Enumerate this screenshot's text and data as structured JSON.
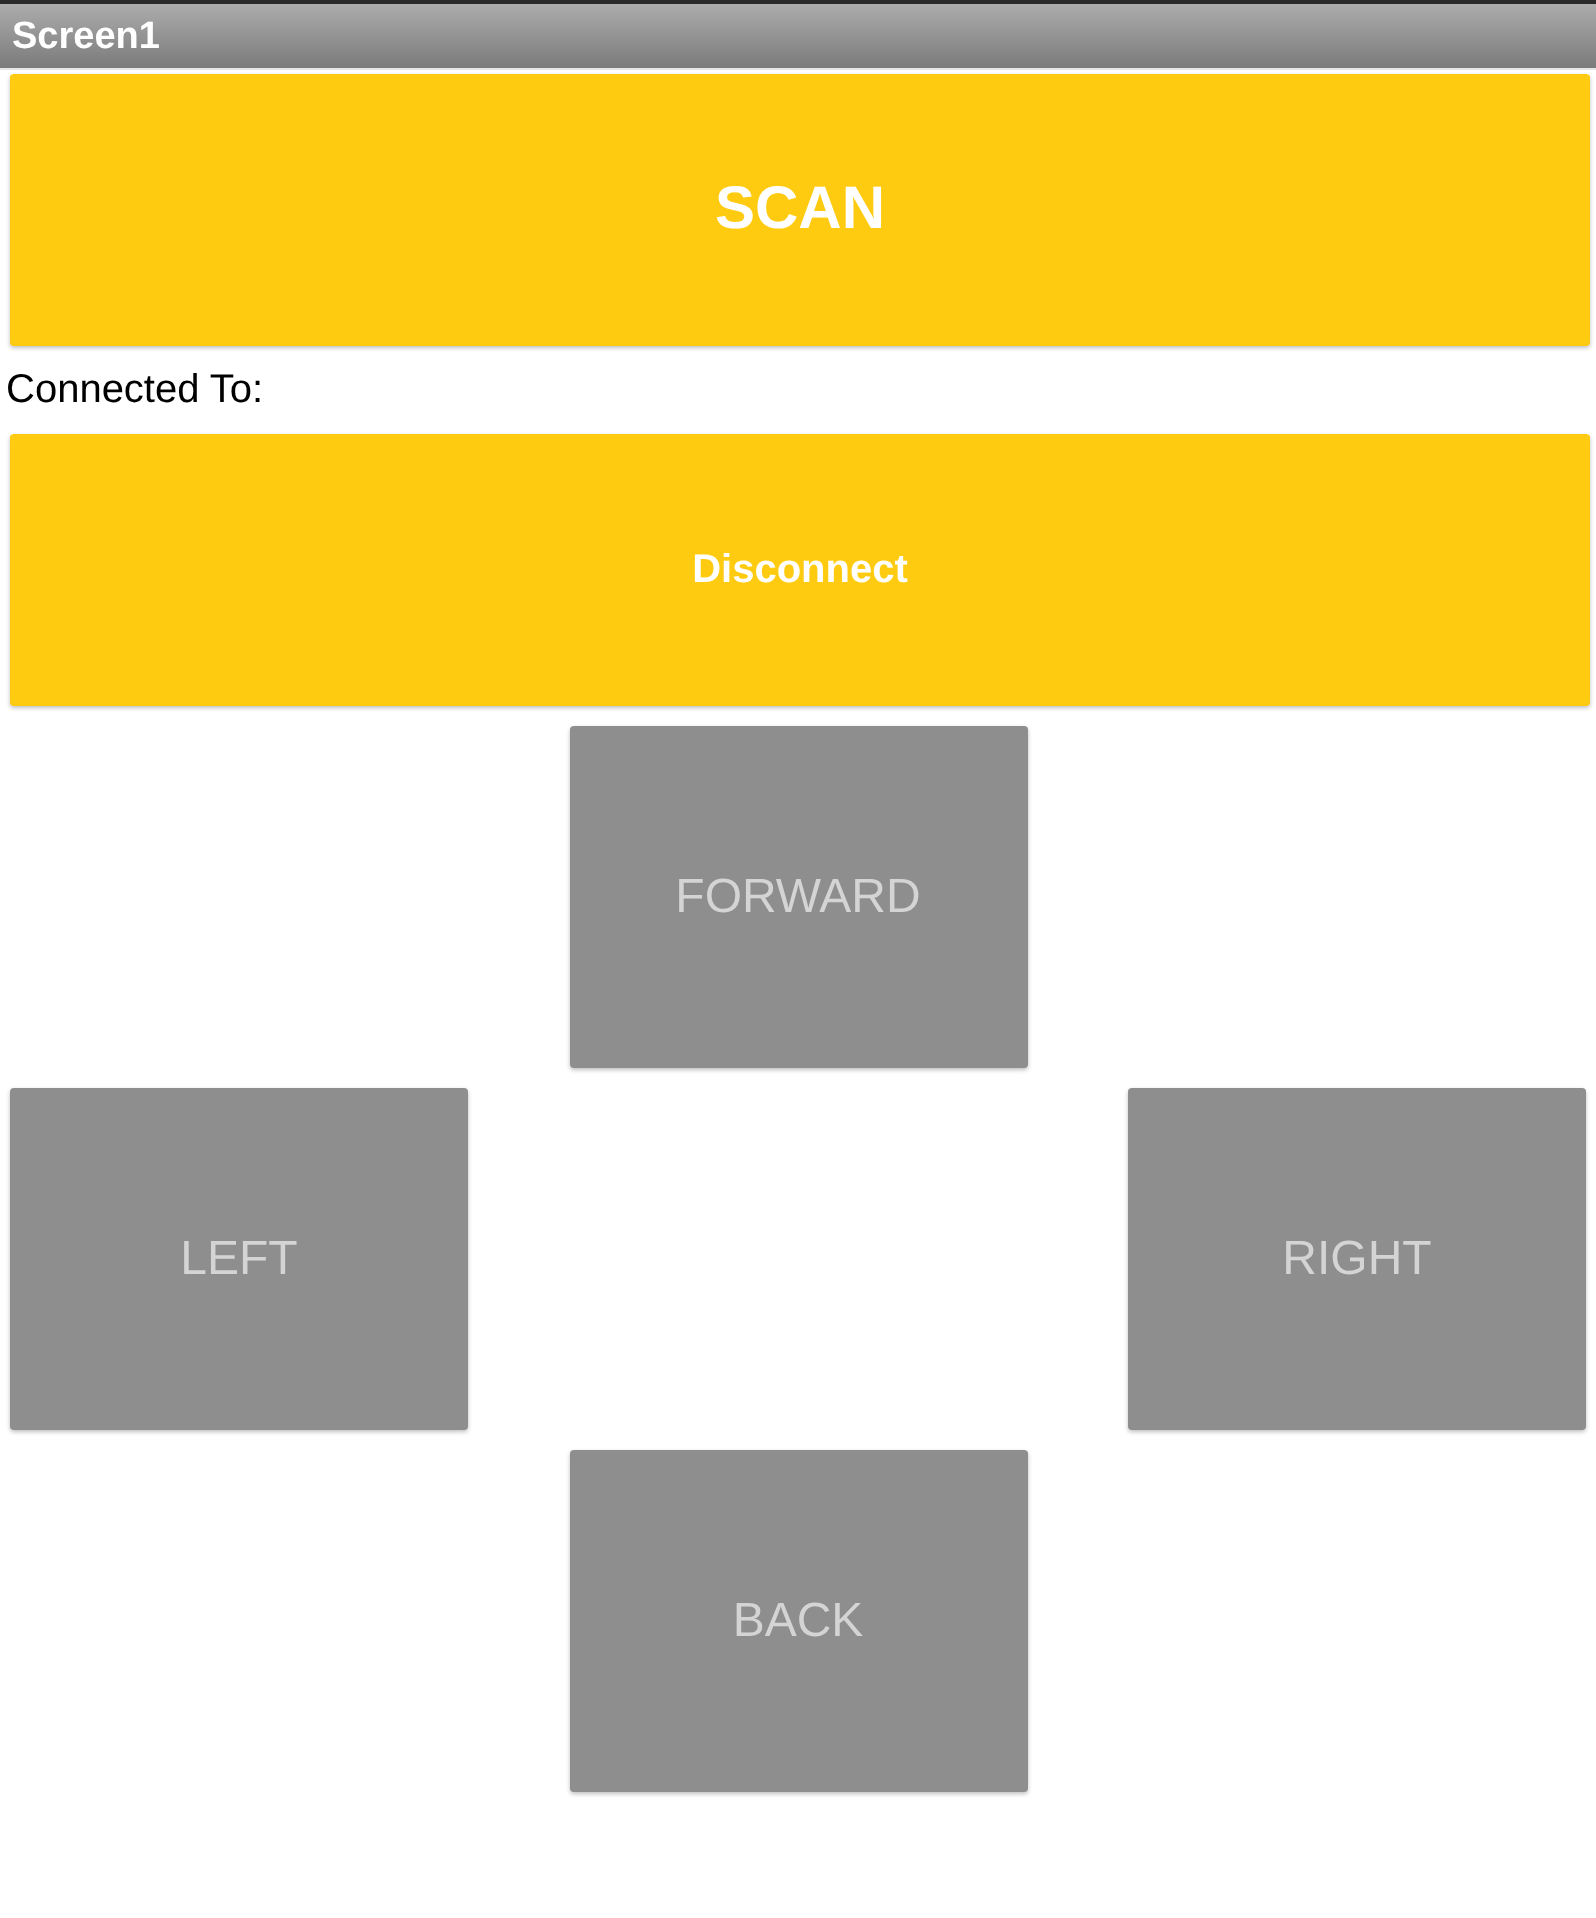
{
  "title_bar": {
    "title": "Screen1"
  },
  "scan_button": {
    "label": "SCAN"
  },
  "connection_label": "Connected To:",
  "disconnect_button": {
    "label": "Disconnect"
  },
  "direction_buttons": [
    {
      "label": "FORWARD",
      "kind": "up"
    },
    {
      "label": "LEFT",
      "kind": "left"
    },
    {
      "label": "RIGHT",
      "kind": "right"
    },
    {
      "label": "BACK",
      "kind": "down"
    }
  ]
}
